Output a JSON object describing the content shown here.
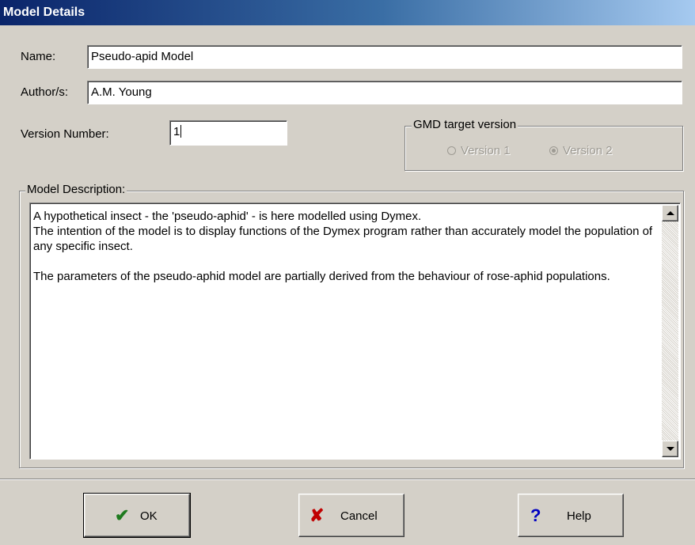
{
  "window": {
    "title": "Model Details"
  },
  "form": {
    "name_label": "Name:",
    "name_value": "Pseudo-apid Model",
    "author_label": "Author/s:",
    "author_value": "A.M. Young",
    "version_label": "Version Number:",
    "version_value": "1"
  },
  "gmd": {
    "title": "GMD target version",
    "option1": "Version 1",
    "option2": "Version 2",
    "selected": "Version 2",
    "enabled": false
  },
  "description": {
    "title": "Model Description:",
    "line1": "A hypothetical insect - the 'pseudo-aphid' - is here modelled using Dymex.",
    "line2": "The intention of the model is to display functions of the Dymex program rather than accurately model the population of any specific insect.",
    "line3": "The parameters of the pseudo-aphid model are partially derived from the behaviour of rose-aphid populations."
  },
  "buttons": {
    "ok": "OK",
    "cancel": "Cancel",
    "help": "Help"
  },
  "icons": {
    "ok": "checkmark-icon",
    "cancel": "x-icon",
    "help": "question-mark-icon",
    "ok_color": "#1e7a1e",
    "cancel_color": "#c00000",
    "help_color": "#0000c0"
  }
}
